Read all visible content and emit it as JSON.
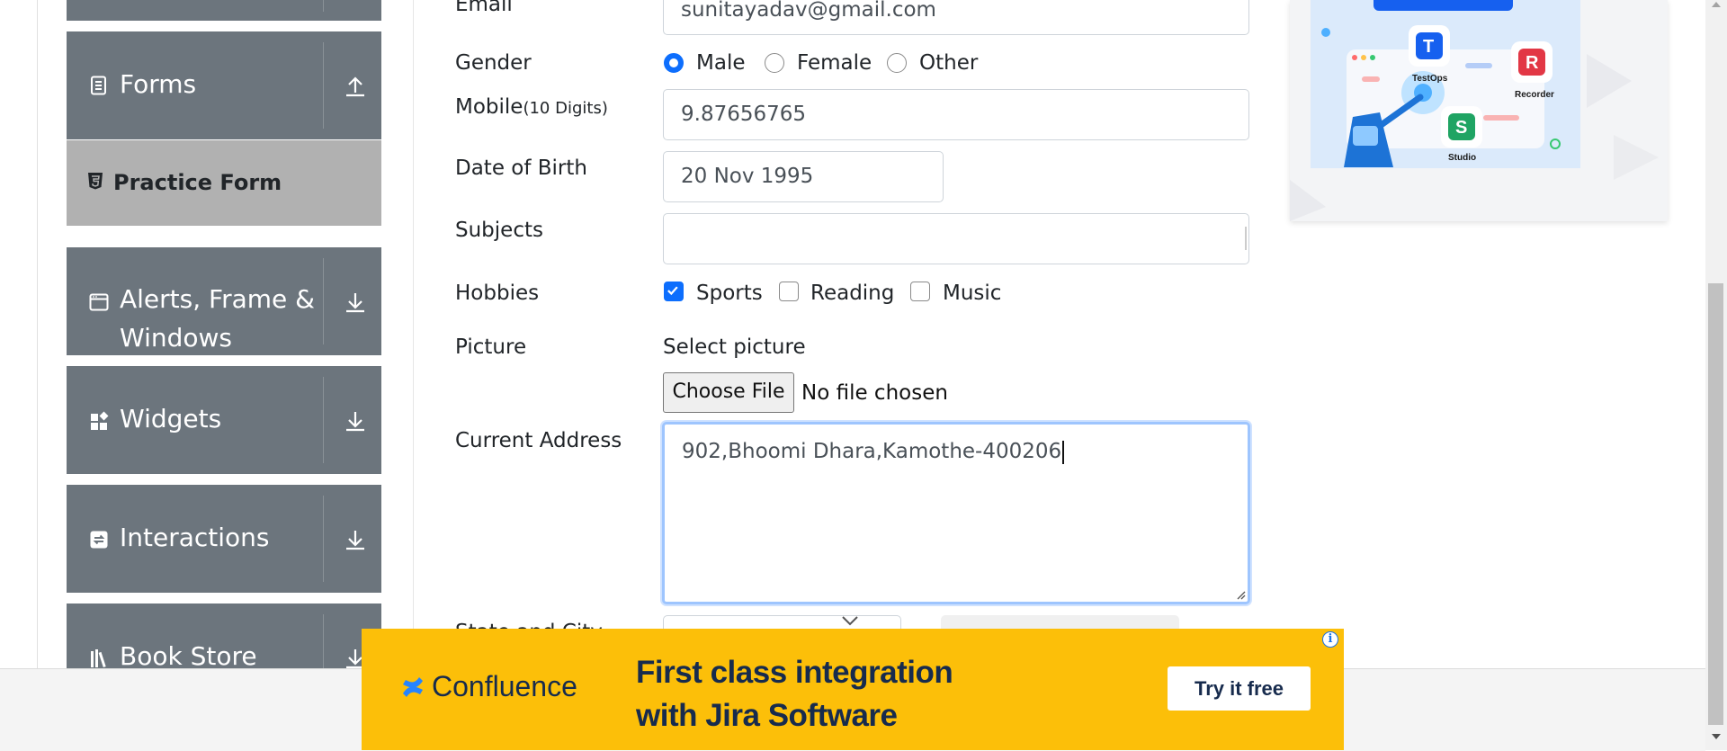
{
  "sidebar": {
    "groups": [
      {
        "label": "Forms",
        "icon": "document-icon",
        "arrow": "upload-icon"
      },
      {
        "label_line1": "Alerts, Frame &",
        "label_line2": "Windows",
        "icon": "browser-window-icon",
        "arrow": "download-icon"
      },
      {
        "label": "Widgets",
        "icon": "widgets-icon",
        "arrow": "download-icon"
      },
      {
        "label": "Interactions",
        "icon": "interactions-icon",
        "arrow": "download-icon"
      },
      {
        "label": "Book Store",
        "icon": "books-icon",
        "arrow": "download-icon"
      }
    ],
    "active_item": {
      "label": "Practice Form",
      "icon": "html5-icon"
    }
  },
  "form": {
    "email": {
      "label": "Email",
      "value": "sunitayadav@gmail.com"
    },
    "gender": {
      "label": "Gender",
      "options": [
        "Male",
        "Female",
        "Other"
      ],
      "selected": "Male"
    },
    "mobile": {
      "label": "Mobile",
      "hint": "(10 Digits)",
      "value": "9.87656765"
    },
    "dob": {
      "label": "Date of Birth",
      "value": "20 Nov 1995"
    },
    "subjects": {
      "label": "Subjects",
      "value": ""
    },
    "hobbies": {
      "label": "Hobbies",
      "options": [
        "Sports",
        "Reading",
        "Music"
      ],
      "checked": [
        "Sports"
      ]
    },
    "picture": {
      "label": "Picture",
      "prompt": "Select picture",
      "button": "Choose File",
      "status": "No file chosen"
    },
    "address": {
      "label": "Current Address",
      "value": "902,Bhoomi Dhara,Kamothe-400206"
    },
    "state_city": {
      "label": "State and City"
    }
  },
  "side_ad": {
    "labels": [
      "TestOps",
      "Recorder",
      "Studio"
    ]
  },
  "banner_ad": {
    "brand": "Confluence",
    "headline_line1": "First class integration",
    "headline_line2": "with Jira Software",
    "cta": "Try it free",
    "colors": {
      "background": "#fcbf09",
      "brand_blue": "#2684ff",
      "text": "#172b4d"
    }
  },
  "colors": {
    "sidebar_header": "#6c757d",
    "sidebar_active": "#b1b1b1",
    "primary": "#0d6efd",
    "focus_ring": "#9ec5fe"
  }
}
